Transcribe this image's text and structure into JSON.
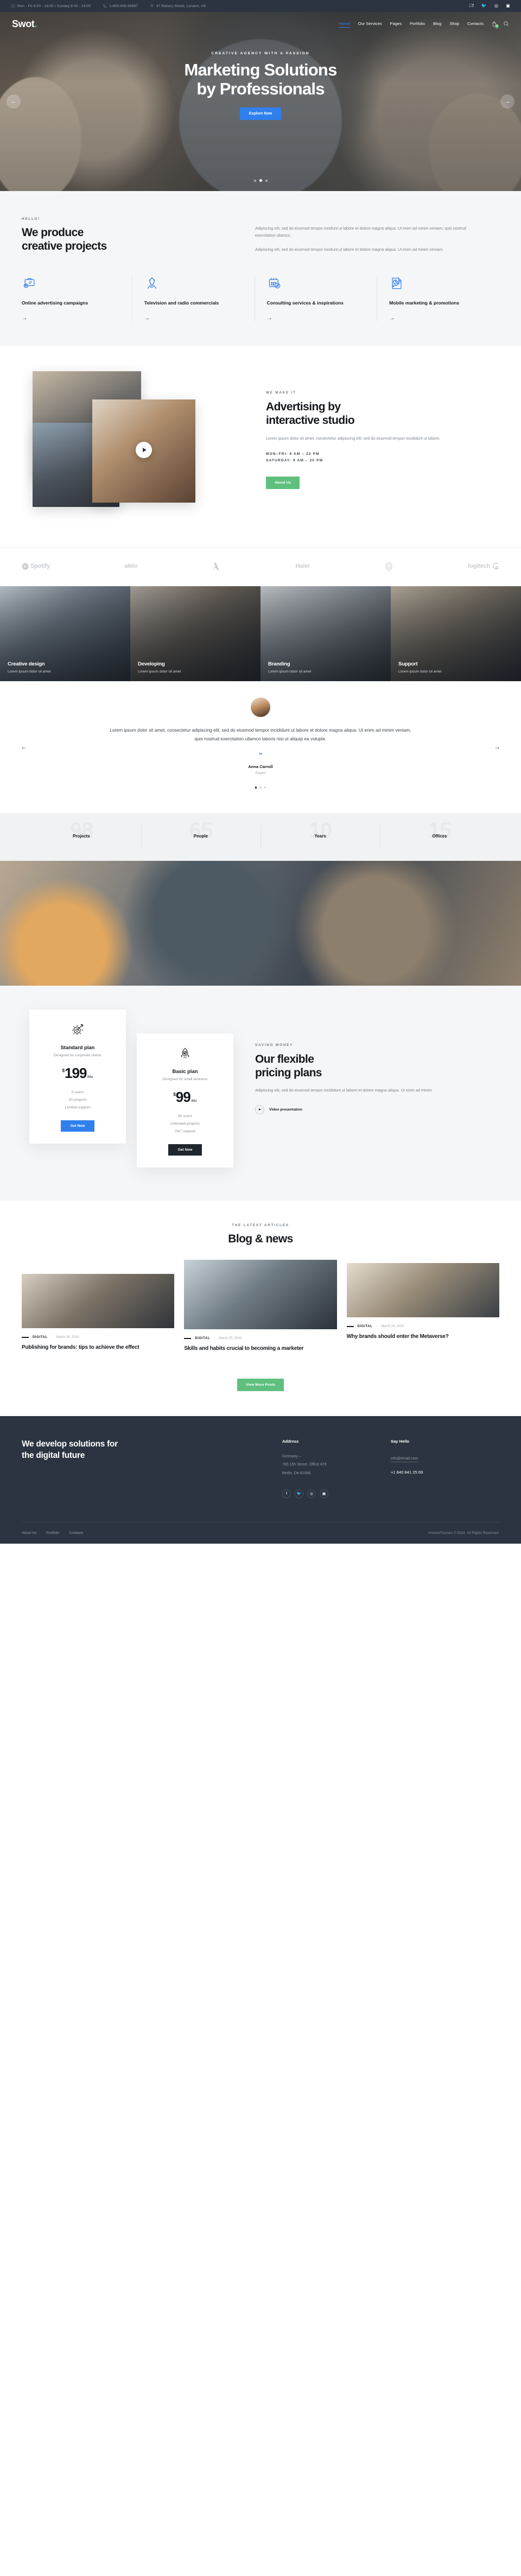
{
  "topbar": {
    "hours": "Mon - Fri 8:00 - 18:00 / Sunday 8:00 - 14:00",
    "phone": "1-800-458-56987",
    "address": "47 Bakery Street, London, UK",
    "socials": [
      "facebook-icon",
      "twitter-icon",
      "dribbble-icon",
      "instagram-icon"
    ]
  },
  "nav": {
    "logo": "Swot",
    "logo_dot": ".",
    "items": [
      {
        "label": "Home",
        "active": true
      },
      {
        "label": "Our Services",
        "active": false
      },
      {
        "label": "Pages",
        "active": false
      },
      {
        "label": "Portfolio",
        "active": false
      },
      {
        "label": "Blog",
        "active": false
      },
      {
        "label": "Shop",
        "active": false
      },
      {
        "label": "Contacts",
        "active": false
      }
    ],
    "cart_count": "0"
  },
  "hero": {
    "eyebrow": "CREATIVE AGENCY WITH A PASSION",
    "title_line1": "Marketing Solutions",
    "title_line2": "by Professionals",
    "cta": "Explore Now",
    "prev": "←",
    "next": "→",
    "slides": 3,
    "active_slide": 2
  },
  "produce": {
    "eyebrow": "HELLO!",
    "title_line1": "We produce",
    "title_line2": "creative projects",
    "paragraph_1": "Adipiscing elit, sed do eiusmod tempor incidunt ut labore et dolore magna aliqua. Ut enim ad minim veniam, quis nostrud exercitation ullamco.",
    "paragraph_2": "Adipiscing elit, sed do eiusmod tempor incidunt ut labore et dolore magna aliqua. Ut enim ad minim veniam.",
    "services": [
      {
        "icon": "briefcase-gear-icon",
        "title": "Online advertising campaigns",
        "arrow": "→"
      },
      {
        "icon": "lightbulb-person-icon",
        "title": "Television and radio commercials",
        "arrow": "→"
      },
      {
        "icon": "calendar-chart-icon",
        "title": "Consulting services & inspirations",
        "arrow": "→"
      },
      {
        "icon": "report-chart-icon",
        "title": "Mobile marketing & promotions",
        "arrow": "→"
      }
    ]
  },
  "advertising": {
    "eyebrow": "WE MAKE IT",
    "title_line1": "Advertising by",
    "title_line2": "interactive studio",
    "paragraph": "Lorem ipsum dolor sit amet, consectetur adipiscing elit, sed do eiusmod tempor incididunt ut labore.",
    "hours_weekday": "MON–FRI: 9 AM – 22 PM",
    "hours_saturday": "SATURDAY: 9 AM – 20 PM",
    "cta": "About Us",
    "play_icon": "play-icon"
  },
  "brands": [
    {
      "name": "Spotify",
      "icon": "spotify-icon"
    },
    {
      "name": "alelo",
      "icon": "alelo-icon"
    },
    {
      "name": "Adobe",
      "icon": "adobe-icon"
    },
    {
      "name": "Haier",
      "icon": "haier-icon"
    },
    {
      "name": "B",
      "icon": "bose-icon"
    },
    {
      "name": "logitech",
      "icon": "logitech-icon"
    }
  ],
  "tiles": [
    {
      "title": "Creative design",
      "sub": "Lorem ipsum dolor sit amet"
    },
    {
      "title": "Developing",
      "sub": "Lorem ipsum dolor sit amet"
    },
    {
      "title": "Branding",
      "sub": "Lorem ipsum dolor sit amet"
    },
    {
      "title": "Support",
      "sub": "Lorem ipsum dolor sit amet"
    }
  ],
  "testimonial": {
    "text": "Lorem ipsum dolor sit amet, consectetur adipiscing elit, sed do eiusmod tempor incididunt ut labore et dolore magna aliqua. Ut enim ad minim veniam, quis nostrud exercitation ullamco laboris nisi ut aliquip ea volupte.",
    "quote_icon": "quote-icon",
    "name": "Anna Carroll",
    "role": "Expert",
    "prev": "←",
    "next": "→",
    "dots": 3,
    "active_dot": 1
  },
  "counters": [
    {
      "number": "98",
      "label": "Projects"
    },
    {
      "number": "65",
      "label": "People"
    },
    {
      "number": "10",
      "label": "Years"
    },
    {
      "number": "15",
      "label": "Offices"
    }
  ],
  "pricing": {
    "eyebrow": "SAVING MONEY",
    "title_line1": "Our flexible",
    "title_line2": "pricing plans",
    "paragraph": "Adipiscing elit, sed do eiusmod tempor incididunt ut labore et dolore magna aliqua. Ut enim ad minim.",
    "video_label": "Video presentation",
    "plans": [
      {
        "icon": "target-gear-icon",
        "name": "Standard plan",
        "desc": "Designed for corporate clients",
        "currency": "$",
        "amount": "199",
        "period": "/Mo",
        "features": [
          "5 users",
          "20 projects",
          "Limited support"
        ],
        "cta": "Get Now"
      },
      {
        "icon": "rocket-icon",
        "name": "Basic plan",
        "desc": "Designed for small business",
        "currency": "$",
        "amount": "99",
        "period": "/Mo",
        "features": [
          "50 users",
          "Unlimited projects",
          "24/7 support"
        ],
        "cta": "Get Now"
      }
    ]
  },
  "blog": {
    "eyebrow": "THE LATEST ARTICLES",
    "title": "Blog & news",
    "posts": [
      {
        "category": "DIGITAL",
        "sep": "·",
        "date": "March 26, 2020",
        "title": "Publishing for brands: tips to achieve the effect"
      },
      {
        "category": "DIGITAL",
        "sep": "·",
        "date": "March 25, 2020",
        "title": "Skills and habits crucial to becoming a marketer"
      },
      {
        "category": "DIGITAL",
        "sep": "·",
        "date": "March 24, 2020",
        "title": "Why brands should enter the Metaverse?"
      }
    ],
    "more_cta": "View More Posts"
  },
  "footer": {
    "headline_line1": "We develop solutions for",
    "headline_line2": "the digital future",
    "address_title": "Address",
    "address_line1": "Germany –",
    "address_line2": "785 15h Street, Office 478",
    "address_line3": "Berlin, De 81566",
    "hello_title": "Say Hello",
    "email": "info@email.com",
    "phone": "+1 840 841 25 69",
    "socials": [
      "facebook-icon",
      "twitter-icon",
      "dribbble-icon",
      "instagram-icon"
    ],
    "links": [
      "About Us",
      "Portfolio",
      "Contacts"
    ],
    "copyright": "AncoraThemes © 2024. All Rights Reserved."
  }
}
